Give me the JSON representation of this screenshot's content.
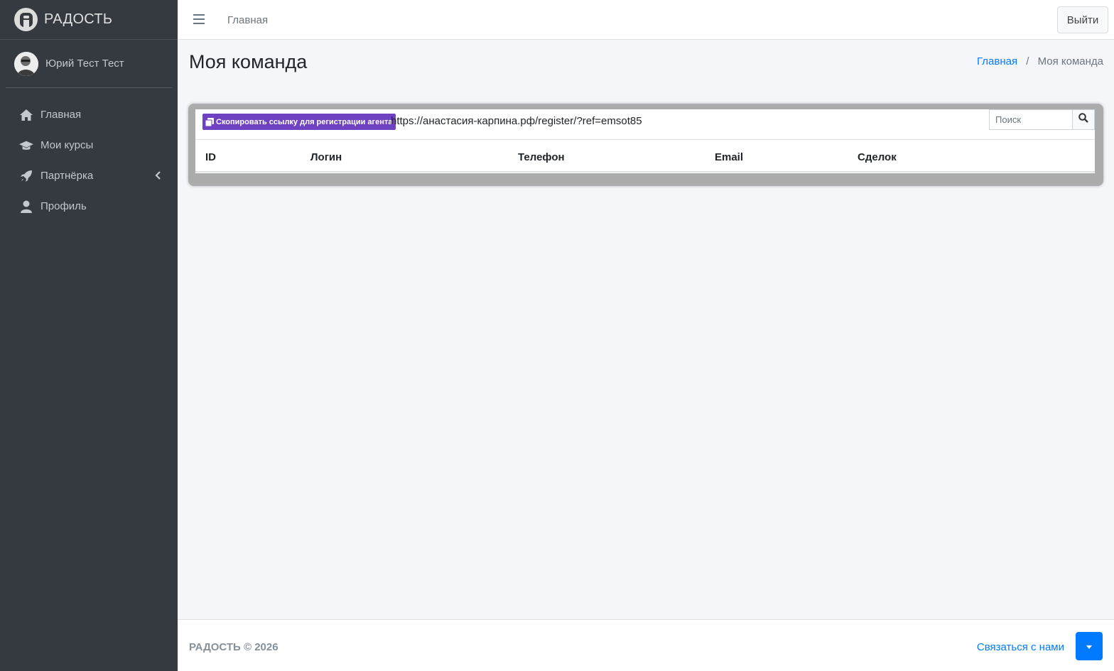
{
  "brand": {
    "name": "РАДОСТЬ"
  },
  "user": {
    "name": "Юрий Тест Тест"
  },
  "sidebar": {
    "items": [
      {
        "label": "Главная",
        "icon": "home-icon"
      },
      {
        "label": "Мои курсы",
        "icon": "graduation-cap-icon"
      },
      {
        "label": "Партнёрка",
        "icon": "rocket-icon",
        "expandable": true
      },
      {
        "label": "Профиль",
        "icon": "user-icon"
      }
    ]
  },
  "topbar": {
    "home_label": "Главная",
    "logout_label": "Выйти"
  },
  "page": {
    "title": "Моя команда"
  },
  "breadcrumb": {
    "home": "Главная",
    "separator": "/",
    "current": "Моя команда"
  },
  "team": {
    "copy_button_label": "Скопировать ссылку для регистрации агента",
    "referral_link": "https://анастасия-карпина.рф/register/?ref=emsot85",
    "search_placeholder": "Поиск",
    "columns": [
      "ID",
      "Логин",
      "Телефон",
      "Email",
      "Сделок"
    ],
    "rows": []
  },
  "footer": {
    "copyright": "РАДОСТЬ © 2026",
    "contact_label": "Связаться с нами"
  },
  "colors": {
    "sidebar_bg": "#343a40",
    "accent": "#007bff",
    "copy_button": "#6f42c1"
  }
}
